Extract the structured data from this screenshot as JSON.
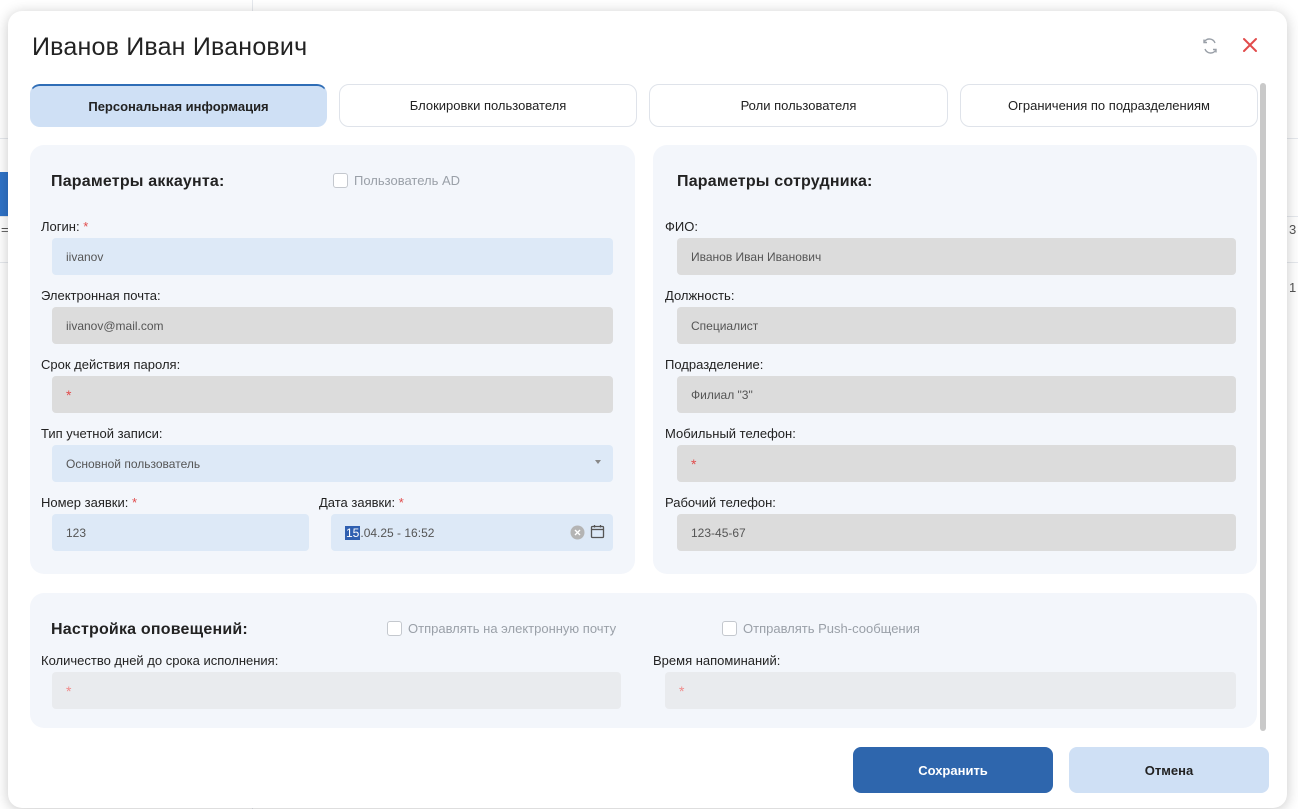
{
  "background": {
    "fragments": [
      "=",
      "1",
      "3"
    ]
  },
  "modal": {
    "title": "Иванов Иван Иванович",
    "icons": {
      "refresh": "refresh-icon",
      "close": "close-icon"
    },
    "close_color": "#e14b4b"
  },
  "tabs": [
    {
      "label": "Персональная информация",
      "active": true
    },
    {
      "label": "Блокировки пользователя",
      "active": false
    },
    {
      "label": "Роли пользователя",
      "active": false
    },
    {
      "label": "Ограничения по подразделениям",
      "active": false
    }
  ],
  "account": {
    "title": "Параметры аккаунта:",
    "ad_checkbox": {
      "label": "Пользователь AD",
      "checked": false
    },
    "login": {
      "label": "Логин:",
      "required_mark": "*",
      "value": "iivanov"
    },
    "email": {
      "label": "Электронная почта:",
      "value": "iivanov@mail.com"
    },
    "password_expiry": {
      "label": "Срок действия пароля:",
      "value": "*"
    },
    "account_type": {
      "label": "Тип учетной записи:",
      "value": "Основной пользователь"
    },
    "request_number": {
      "label": "Номер заявки:",
      "required_mark": "*",
      "value": "123"
    },
    "request_date": {
      "label": "Дата заявки:",
      "required_mark": "*",
      "value_selected": "15",
      "value_rest": ".04.25 - 16:52"
    }
  },
  "employee": {
    "title": "Параметры сотрудника:",
    "fio": {
      "label": "ФИО:",
      "value": "Иванов Иван Иванович"
    },
    "position": {
      "label": "Должность:",
      "value": "Специалист"
    },
    "department": {
      "label": "Подразделение:",
      "value": "Филиал \"3\""
    },
    "mobile": {
      "label": "Мобильный телефон:",
      "value": "*"
    },
    "work_phone": {
      "label": "Рабочий телефон:",
      "value": "123-45-67"
    }
  },
  "notifications": {
    "title": "Настройка оповещений:",
    "email_checkbox": {
      "label": "Отправлять на электронную почту",
      "checked": false
    },
    "push_checkbox": {
      "label": "Отправлять Push-сообщения",
      "checked": false
    },
    "days_before": {
      "label": "Количество дней до срока исполнения:",
      "value": "*"
    },
    "reminder_time": {
      "label": "Время напоминаний:",
      "value": "*"
    }
  },
  "buttons": {
    "save": "Сохранить",
    "cancel": "Отмена"
  },
  "colors": {
    "primary": "#2e66ad",
    "active_tab": "#cfe0f5",
    "panel": "#f3f6fb",
    "required": "#e14b4b"
  }
}
